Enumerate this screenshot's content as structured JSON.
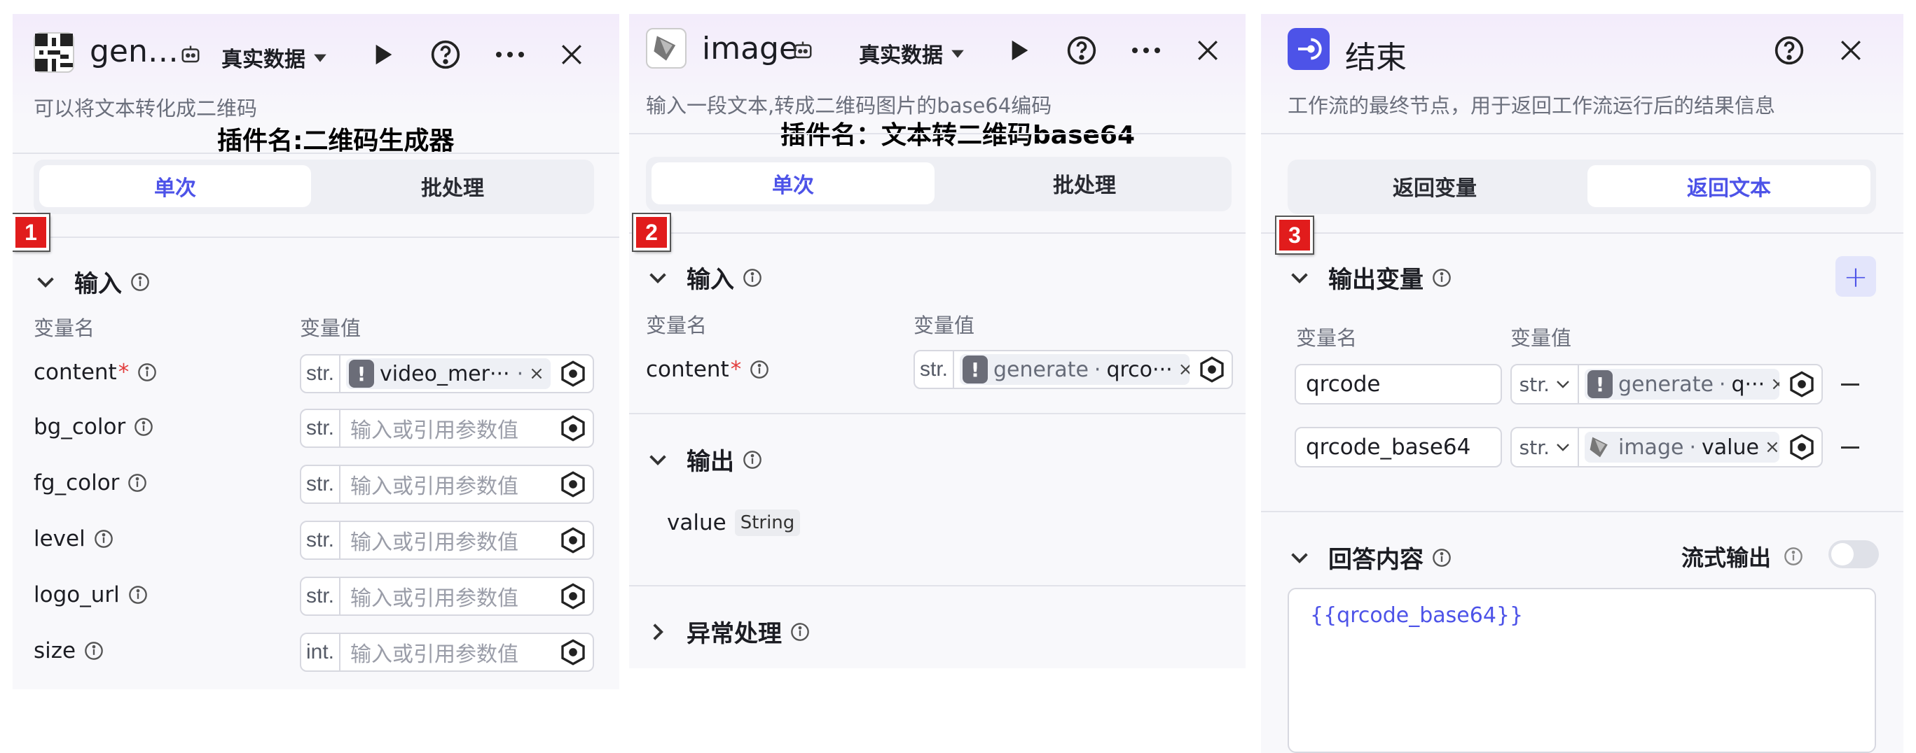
{
  "panel1": {
    "title": "gen…",
    "mode": "真实数据",
    "description": "可以将文本转化成二维码",
    "caption": "插件名:二维码生成器",
    "tabs": [
      "单次",
      "批处理"
    ],
    "badge": "1",
    "input_section": "输入",
    "col_name": "变量名",
    "col_value": "变量值",
    "params": [
      {
        "name": "content",
        "required": "*",
        "type": "str.",
        "ref_text": "video_mer···",
        "ref_suffix": "·"
      },
      {
        "name": "bg_color",
        "type": "str.",
        "placeholder": "输入或引用参数值"
      },
      {
        "name": "fg_color",
        "type": "str.",
        "placeholder": "输入或引用参数值"
      },
      {
        "name": "level",
        "type": "str.",
        "placeholder": "输入或引用参数值"
      },
      {
        "name": "logo_url",
        "type": "str.",
        "placeholder": "输入或引用参数值"
      },
      {
        "name": "size",
        "type": "int.",
        "placeholder": "输入或引用参数值"
      }
    ]
  },
  "panel2": {
    "title": "image",
    "mode": "真实数据",
    "description": "输入一段文本,转成二维码图片的base64编码",
    "caption": "插件名：文本转二维码base64",
    "tabs": [
      "单次",
      "批处理"
    ],
    "badge": "2",
    "input_section": "输入",
    "col_name": "变量名",
    "col_value": "变量值",
    "param": {
      "name": "content",
      "required": "*",
      "type": "str.",
      "ref_node": "generate",
      "ref_var": "qrco···"
    },
    "output_section": "输出",
    "output": {
      "name": "value",
      "type": "String"
    },
    "exception_section": "异常处理"
  },
  "panel3": {
    "title": "结束",
    "description": "工作流的最终节点，用于返回工作流运行后的结果信息",
    "tabs": [
      "返回变量",
      "返回文本"
    ],
    "badge": "3",
    "output_section": "输出变量",
    "col_name": "变量名",
    "col_value": "变量值",
    "vars": [
      {
        "name": "qrcode",
        "type": "str.",
        "ref_node": "generate",
        "ref_var": "q···"
      },
      {
        "name": "qrcode_base64",
        "type": "str.",
        "ref_node": "image",
        "ref_var": "value"
      }
    ],
    "answer_section": "回答内容",
    "stream_label": "流式输出",
    "answer_template": "{{qrcode_base64}}"
  },
  "colors": {
    "accent": "#4d53e8",
    "badge": "#e11c1c",
    "required": "#e23c3c"
  }
}
